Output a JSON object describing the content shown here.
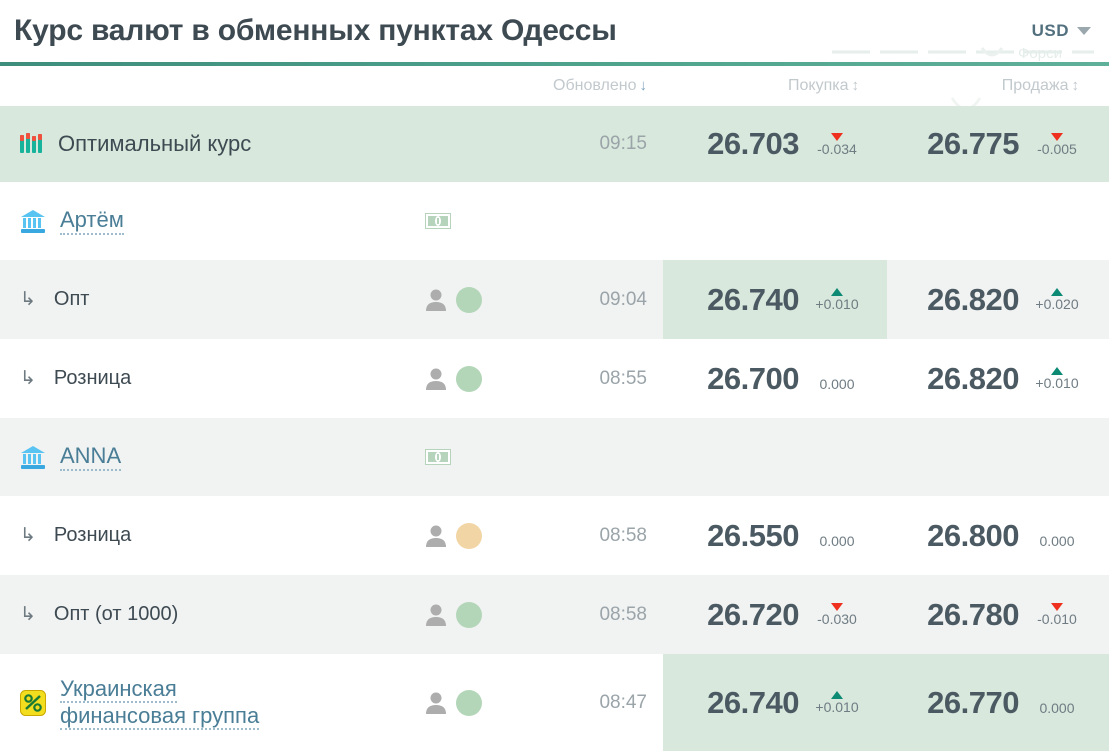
{
  "header": {
    "title": "Курс валют в обменных пунктах Одессы",
    "currency": "USD",
    "currency_caret_icon": "chevron-down-icon"
  },
  "columns": {
    "name": "",
    "badge": "",
    "updated": "Обновлено",
    "updated_sort": "↓",
    "buy": "Покупка",
    "buy_sort": "↕",
    "sell": "Продажа",
    "sell_sort": "↕"
  },
  "colors": {
    "accent_rule": "#4c9e8a",
    "highlight_cell": "#d8e8dc",
    "row_shade": "#f1f2f2",
    "up_arrow": "#0d8a74",
    "down_arrow": "#f0301f",
    "link": "#4a7d96",
    "dot_green": "#b3d6b8",
    "dot_amber": "#f2d5a4"
  },
  "rows": [
    {
      "kind": "optimal",
      "icon": "bars-icon",
      "name": "Оптимальный курс",
      "time": "09:15",
      "buy": {
        "value": "26.703",
        "delta": "-0.034",
        "dir": "down",
        "highlight": false
      },
      "sell": {
        "value": "26.775",
        "delta": "-0.005",
        "dir": "down",
        "highlight": false
      }
    },
    {
      "kind": "group",
      "icon": "bank-icon",
      "name": "Артём",
      "link": true,
      "badge_icon": "banknote-icon"
    },
    {
      "kind": "sub",
      "shade": true,
      "arrow": "↳",
      "name": "Опт",
      "person_icon": "person-icon",
      "dot": "green",
      "time": "09:04",
      "buy": {
        "value": "26.740",
        "delta": "+0.010",
        "dir": "up",
        "highlight": true
      },
      "sell": {
        "value": "26.820",
        "delta": "+0.020",
        "dir": "up",
        "highlight": false
      }
    },
    {
      "kind": "sub",
      "shade": false,
      "arrow": "↳",
      "name": "Розница",
      "person_icon": "person-icon",
      "dot": "green",
      "time": "08:55",
      "buy": {
        "value": "26.700",
        "delta": "0.000",
        "dir": "flat",
        "highlight": false
      },
      "sell": {
        "value": "26.820",
        "delta": "+0.010",
        "dir": "up",
        "highlight": false
      }
    },
    {
      "kind": "group",
      "icon": "bank-icon",
      "name": "ANNA",
      "link": true,
      "badge_icon": "banknote-icon"
    },
    {
      "kind": "sub",
      "shade": false,
      "arrow": "↳",
      "name": "Розница",
      "person_icon": "person-icon",
      "dot": "amber",
      "time": "08:58",
      "buy": {
        "value": "26.550",
        "delta": "0.000",
        "dir": "flat",
        "highlight": false
      },
      "sell": {
        "value": "26.800",
        "delta": "0.000",
        "dir": "flat",
        "highlight": false
      }
    },
    {
      "kind": "sub",
      "shade": true,
      "arrow": "↳",
      "name": "Опт (от 1000)",
      "person_icon": "person-icon",
      "dot": "green",
      "time": "08:58",
      "buy": {
        "value": "26.720",
        "delta": "-0.030",
        "dir": "down",
        "highlight": false
      },
      "sell": {
        "value": "26.780",
        "delta": "-0.010",
        "dir": "down",
        "highlight": false
      }
    },
    {
      "kind": "provider",
      "icon": "ufg-logo-icon",
      "name_line1": "Украинская",
      "name_line2": "финансовая группа",
      "link": true,
      "person_icon": "person-icon",
      "dot": "green",
      "time": "08:47",
      "buy": {
        "value": "26.740",
        "delta": "+0.010",
        "dir": "up",
        "highlight": true
      },
      "sell": {
        "value": "26.770",
        "delta": "0.000",
        "dir": "flat",
        "highlight": true
      }
    }
  ]
}
